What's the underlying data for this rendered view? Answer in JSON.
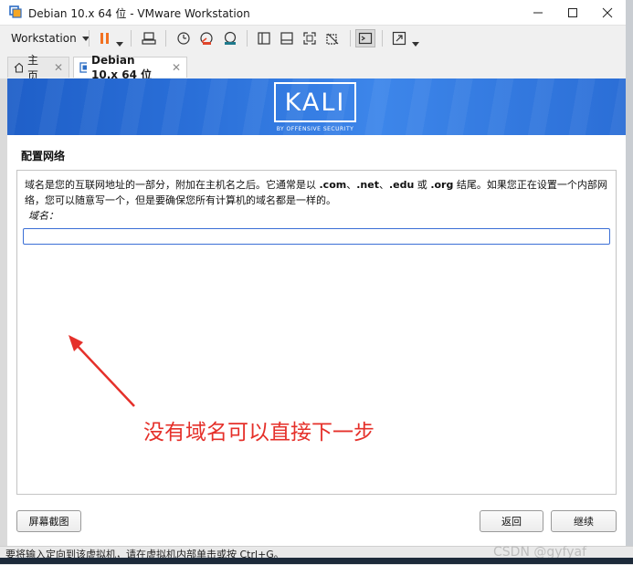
{
  "window": {
    "title": "Debian 10.x 64 位 - VMware Workstation",
    "minimize_icon": "minimize-icon",
    "maximize_icon": "maximize-icon",
    "close_icon": "close-icon"
  },
  "toolbar": {
    "workstation_menu": "Workstation",
    "icons": [
      "pause-icon",
      "send-keys-icon",
      "snapshot-icon",
      "revert-snapshot-icon",
      "manage-snapshots-icon",
      "sidebar-view-icon",
      "tabs-view-icon",
      "fullscreen-icon",
      "unity-icon",
      "console-view-icon",
      "stretch-icon"
    ]
  },
  "tabs": [
    {
      "label": "主页",
      "icon": "home-icon",
      "close": "✕"
    },
    {
      "label": "Debian 10.x 64 位",
      "icon": "vm-icon",
      "close": "✕"
    }
  ],
  "installer": {
    "logo_text": "KALI",
    "logo_subtext": "BY OFFENSIVE SECURITY",
    "section_title": "配置网络",
    "desc_part1": "域名是您的互联网地址的一部分，附加在主机名之后。它通常是以 ",
    "tld1": ".com",
    "sep1": "、",
    "tld2": ".net",
    "sep2": "、",
    "tld3": ".edu",
    "or_text": " 或 ",
    "tld4": ".org",
    "desc_part2": " 结尾。如果您正在设置一个内部网络，您可以随意写一个，但是要确保您所有计算机的域名都是一样的。",
    "field_label": "域名：",
    "field_value": "",
    "screenshot_button": "屏幕截图",
    "back_button": "返回",
    "continue_button": "继续"
  },
  "annotation": {
    "text": "没有域名可以直接下一步",
    "color": "#e5302a"
  },
  "statusbar": {
    "text": "要将输入定向到该虚拟机，请在虚拟机内部单击或按 Ctrl+G。",
    "watermark": "CSDN @gyfyaf"
  },
  "colors": {
    "banner": "#2a6fd8",
    "input_border": "#3b6fd6",
    "annotation": "#e5302a"
  }
}
